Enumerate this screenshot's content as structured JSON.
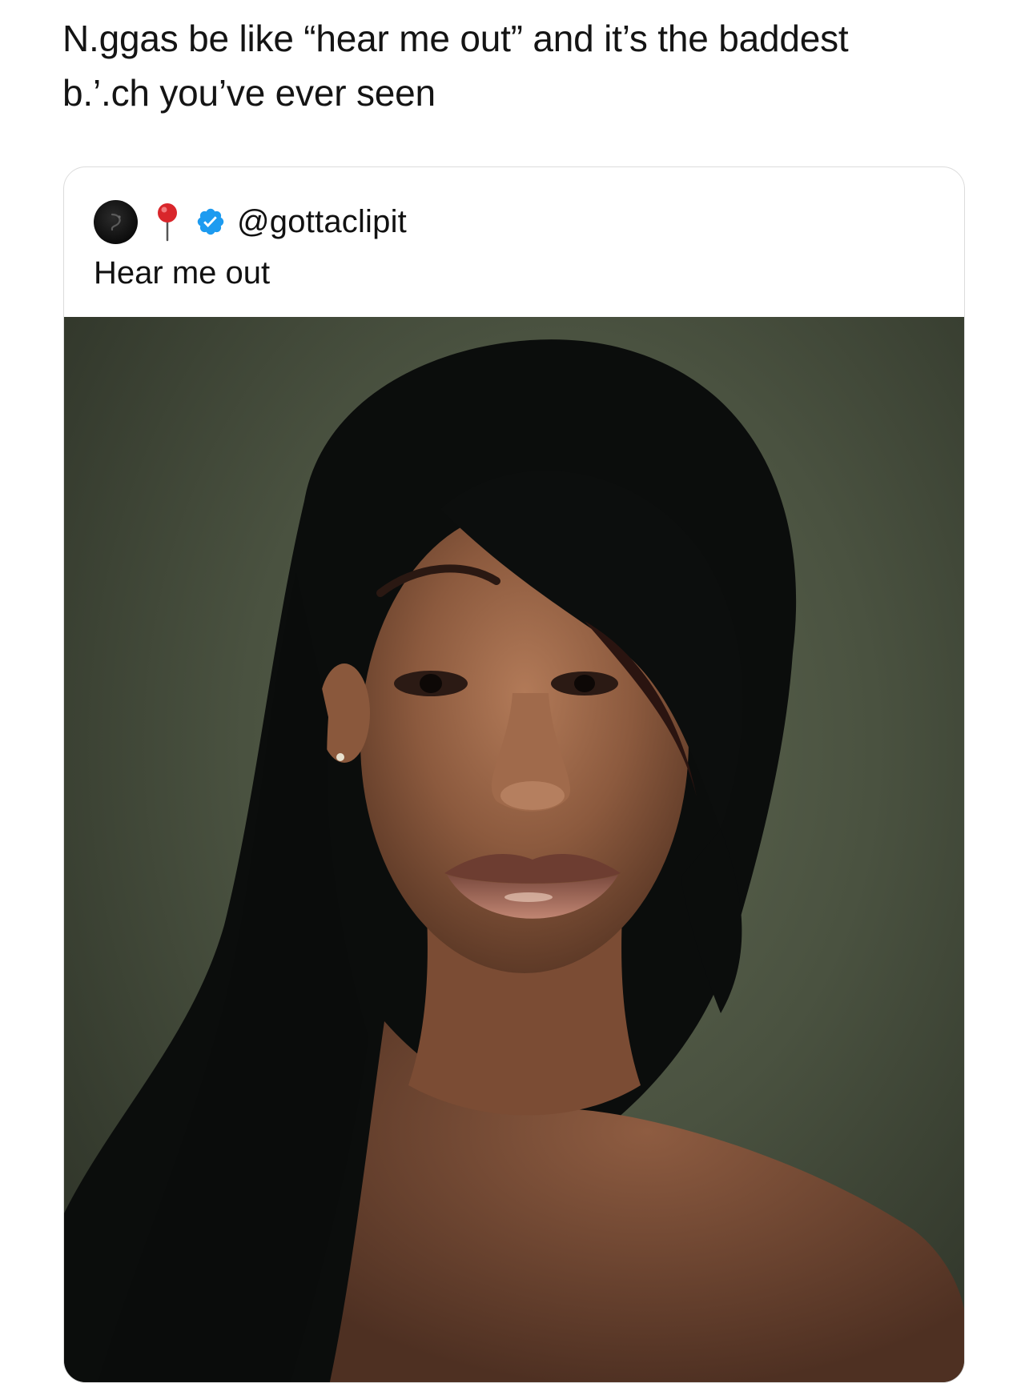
{
  "caption": {
    "line1": "N.ggas be like “hear me out” and it’s the baddest",
    "line2": "b.’.ch you’ve ever seen"
  },
  "tweet": {
    "avatar_icon": "avatar-icon",
    "pin_icon": "round-pushpin-icon",
    "verified_icon": "verified-badge-icon",
    "handle": "@gottaclipit",
    "text": "Hear me out"
  },
  "colors": {
    "verified_blue": "#1d9bf0",
    "pin_red": "#d9262b",
    "photo_background": "#4a5240"
  }
}
